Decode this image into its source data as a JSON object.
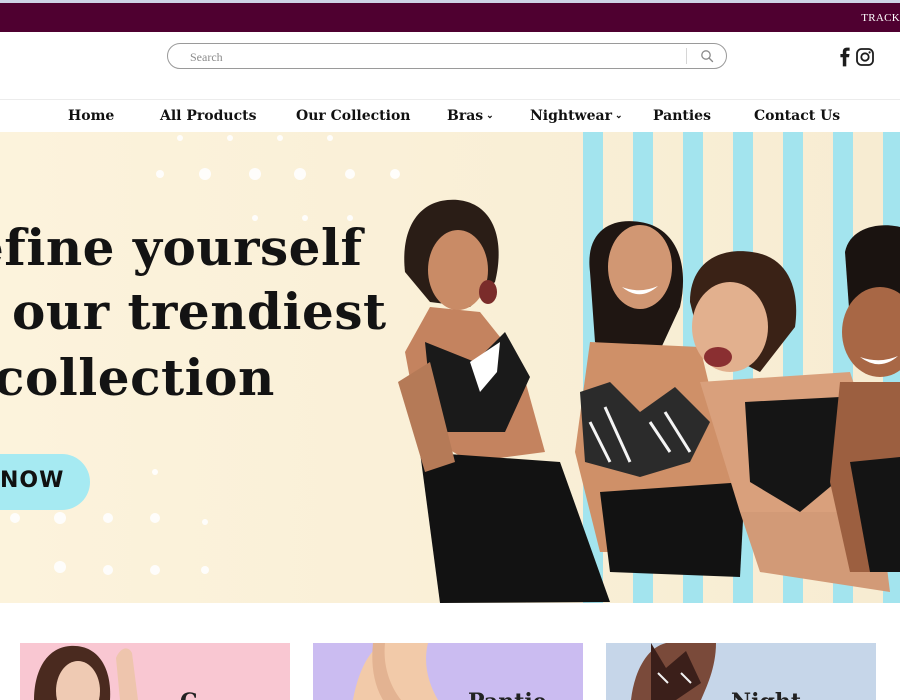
{
  "announcement": {
    "text": "TRACK"
  },
  "search": {
    "placeholder": "Search"
  },
  "social": {
    "icons": [
      "facebook-icon",
      "instagram-icon"
    ]
  },
  "nav": {
    "items": [
      {
        "label": "Home",
        "has_dropdown": false
      },
      {
        "label": "All Products",
        "has_dropdown": false
      },
      {
        "label": "Our Collection",
        "has_dropdown": false
      },
      {
        "label": "Bras",
        "has_dropdown": true
      },
      {
        "label": "Nightwear",
        "has_dropdown": true
      },
      {
        "label": "Panties",
        "has_dropdown": false
      },
      {
        "label": "Contact Us",
        "has_dropdown": false
      }
    ],
    "chevron": "⌄"
  },
  "hero": {
    "headline_lines": [
      "efine yourself",
      "our trendiest",
      "collection"
    ],
    "cta_label": "NOW"
  },
  "category_cards": [
    {
      "title": "C"
    },
    {
      "title": "Pantie"
    },
    {
      "title": "Night"
    }
  ],
  "colors": {
    "announcement_bg": "#4f0030",
    "hero_bg": "#faf0d6",
    "stripe": "#a3e4ee",
    "cta_bg": "#a6eaf2",
    "card_pink": "#f9c7d2",
    "card_lavender": "#cbbcf1",
    "card_blue": "#c6d6e9"
  }
}
